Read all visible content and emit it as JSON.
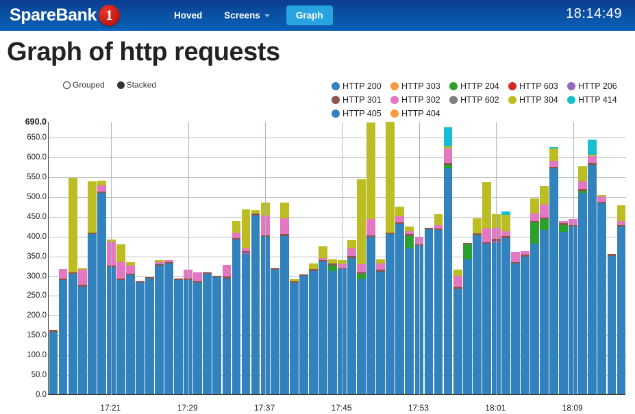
{
  "navbar": {
    "brand_text": "SpareBank",
    "brand_mark": "1",
    "links": [
      {
        "label": "Hoved",
        "active": false,
        "caret": false
      },
      {
        "label": "Screens",
        "active": false,
        "caret": true
      },
      {
        "label": "Graph",
        "active": true,
        "caret": false
      }
    ],
    "clock": "18:14:49",
    "bg_color": "#0a4fa0",
    "active_color": "#27a3e0"
  },
  "page": {
    "title": "Graph of http requests"
  },
  "mode_toggle": {
    "options": [
      {
        "label": "Grouped",
        "selected": false
      },
      {
        "label": "Stacked",
        "selected": true
      }
    ]
  },
  "chart_data": {
    "type": "bar",
    "stacked": true,
    "title": "Graph of http requests",
    "xlabel": "",
    "ylabel": "",
    "ylim": [
      0,
      690
    ],
    "ytick_step": 50,
    "grid": true,
    "legend_position": "top-right",
    "ytick_labels": [
      "0.0",
      "50.0",
      "100.0",
      "150.0",
      "200.0",
      "250.0",
      "300.0",
      "350.0",
      "400.0",
      "450.0",
      "500.0",
      "550.0",
      "600.0",
      "650.0",
      "690.0"
    ],
    "xtick_labels": [
      "17:21",
      "17:29",
      "17:37",
      "17:45",
      "17:53",
      "18:01",
      "18:09"
    ],
    "xtick_indices": [
      6,
      14,
      22,
      30,
      38,
      46,
      54
    ],
    "series": [
      {
        "name": "HTTP 200",
        "color": "#3182bd"
      },
      {
        "name": "HTTP 303",
        "color": "#f99b3a"
      },
      {
        "name": "HTTP 204",
        "color": "#2ca02c"
      },
      {
        "name": "HTTP 603",
        "color": "#d62728"
      },
      {
        "name": "HTTP 206",
        "color": "#9467bd"
      },
      {
        "name": "HTTP 301",
        "color": "#8c564b"
      },
      {
        "name": "HTTP 302",
        "color": "#e377c2"
      },
      {
        "name": "HTTP 602",
        "color": "#7f7f7f"
      },
      {
        "name": "HTTP 304",
        "color": "#bcbd22"
      },
      {
        "name": "HTTP 414",
        "color": "#17becf"
      },
      {
        "name": "HTTP 405",
        "color": "#3182bd"
      },
      {
        "name": "HTTP 404",
        "color": "#f99b3a"
      }
    ],
    "bars": [
      {
        "values": [
          158,
          0,
          0,
          0,
          0,
          5,
          0,
          0,
          0,
          0,
          0,
          0
        ]
      },
      {
        "values": [
          288,
          0,
          0,
          0,
          0,
          4,
          24,
          0,
          0,
          0,
          0,
          0
        ]
      },
      {
        "values": [
          305,
          0,
          0,
          0,
          0,
          3,
          0,
          0,
          238,
          0,
          0,
          0
        ]
      },
      {
        "values": [
          272,
          0,
          0,
          0,
          0,
          4,
          38,
          0,
          4,
          0,
          0,
          0
        ]
      },
      {
        "values": [
          404,
          0,
          0,
          0,
          0,
          5,
          0,
          0,
          128,
          0,
          0,
          0
        ]
      },
      {
        "values": [
          508,
          0,
          0,
          0,
          0,
          4,
          16,
          0,
          12,
          0,
          0,
          0
        ]
      },
      {
        "values": [
          322,
          0,
          0,
          0,
          0,
          4,
          58,
          0,
          6,
          0,
          0,
          0
        ]
      },
      {
        "values": [
          289,
          0,
          0,
          0,
          0,
          4,
          40,
          0,
          45,
          0,
          0,
          0
        ]
      },
      {
        "values": [
          301,
          0,
          0,
          0,
          0,
          3,
          22,
          0,
          8,
          0,
          0,
          0
        ]
      },
      {
        "values": [
          282,
          0,
          0,
          0,
          0,
          3,
          0,
          0,
          0,
          0,
          0,
          0
        ]
      },
      {
        "values": [
          292,
          0,
          0,
          0,
          0,
          3,
          0,
          0,
          0,
          0,
          0,
          0
        ]
      },
      {
        "values": [
          326,
          0,
          0,
          0,
          0,
          3,
          5,
          0,
          5,
          0,
          0,
          0
        ]
      },
      {
        "values": [
          330,
          0,
          0,
          0,
          0,
          3,
          6,
          0,
          0,
          0,
          0,
          0
        ]
      },
      {
        "values": [
          289,
          0,
          0,
          0,
          0,
          3,
          0,
          0,
          0,
          0,
          0,
          0
        ]
      },
      {
        "values": [
          289,
          0,
          0,
          0,
          0,
          4,
          22,
          0,
          0,
          0,
          0,
          0
        ]
      },
      {
        "values": [
          282,
          0,
          0,
          0,
          0,
          4,
          22,
          0,
          0,
          0,
          0,
          0
        ]
      },
      {
        "values": [
          304,
          0,
          0,
          0,
          0,
          3,
          0,
          0,
          0,
          0,
          0,
          0
        ]
      },
      {
        "values": [
          296,
          0,
          0,
          0,
          0,
          4,
          0,
          0,
          0,
          0,
          0,
          0
        ]
      },
      {
        "values": [
          293,
          0,
          0,
          0,
          0,
          4,
          30,
          0,
          0,
          0,
          0,
          0
        ]
      },
      {
        "values": [
          390,
          0,
          0,
          0,
          0,
          4,
          14,
          0,
          30,
          0,
          0,
          0
        ]
      },
      {
        "values": [
          352,
          0,
          0,
          0,
          6,
          4,
          6,
          0,
          99,
          0,
          0,
          0
        ]
      },
      {
        "values": [
          452,
          0,
          0,
          0,
          0,
          4,
          0,
          0,
          10,
          0,
          0,
          0
        ]
      },
      {
        "values": [
          398,
          0,
          0,
          0,
          0,
          4,
          50,
          0,
          32,
          0,
          0,
          0
        ]
      },
      {
        "values": [
          314,
          0,
          0,
          0,
          0,
          4,
          0,
          0,
          0,
          0,
          0,
          0
        ]
      },
      {
        "values": [
          400,
          0,
          0,
          0,
          0,
          4,
          40,
          0,
          40,
          0,
          0,
          0
        ]
      },
      {
        "values": [
          282,
          0,
          0,
          0,
          0,
          3,
          0,
          0,
          5,
          0,
          0,
          0
        ]
      },
      {
        "values": [
          300,
          0,
          0,
          0,
          0,
          3,
          0,
          0,
          0,
          0,
          0,
          0
        ]
      },
      {
        "values": [
          312,
          0,
          0,
          0,
          0,
          4,
          0,
          0,
          15,
          0,
          0,
          0
        ]
      },
      {
        "values": [
          335,
          0,
          0,
          0,
          0,
          4,
          5,
          0,
          30,
          0,
          0,
          0
        ]
      },
      {
        "values": [
          312,
          0,
          14,
          0,
          0,
          4,
          0,
          0,
          10,
          0,
          0,
          0
        ]
      },
      {
        "values": [
          316,
          0,
          0,
          0,
          0,
          3,
          10,
          0,
          10,
          0,
          0,
          0
        ]
      },
      {
        "values": [
          345,
          0,
          0,
          0,
          0,
          4,
          20,
          0,
          20,
          0,
          0,
          0
        ]
      },
      {
        "values": [
          290,
          0,
          14,
          0,
          0,
          4,
          20,
          0,
          215,
          0,
          0,
          0
        ]
      },
      {
        "values": [
          398,
          0,
          0,
          0,
          0,
          4,
          40,
          0,
          245,
          0,
          0,
          0
        ]
      },
      {
        "values": [
          310,
          0,
          0,
          0,
          0,
          4,
          16,
          0,
          10,
          0,
          0,
          0
        ]
      },
      {
        "values": [
          405,
          0,
          0,
          0,
          0,
          4,
          0,
          0,
          280,
          0,
          0,
          0
        ]
      },
      {
        "values": [
          430,
          0,
          0,
          0,
          0,
          4,
          16,
          0,
          24,
          0,
          0,
          0
        ]
      },
      {
        "values": [
          368,
          0,
          32,
          0,
          0,
          4,
          8,
          0,
          12,
          0,
          0,
          0
        ]
      },
      {
        "values": [
          375,
          0,
          0,
          0,
          0,
          4,
          18,
          0,
          0,
          0,
          0,
          0
        ]
      },
      {
        "values": [
          416,
          0,
          0,
          0,
          0,
          4,
          0,
          0,
          0,
          0,
          0,
          0
        ]
      },
      {
        "values": [
          415,
          0,
          0,
          0,
          0,
          4,
          8,
          0,
          28,
          0,
          0,
          0
        ]
      },
      {
        "values": [
          570,
          0,
          10,
          0,
          0,
          4,
          36,
          0,
          6,
          48,
          0,
          0
        ]
      },
      {
        "values": [
          267,
          0,
          0,
          0,
          0,
          4,
          28,
          0,
          16,
          0,
          0,
          0
        ]
      },
      {
        "values": [
          340,
          0,
          38,
          0,
          0,
          4,
          0,
          0,
          0,
          0,
          0,
          0
        ]
      },
      {
        "values": [
          402,
          0,
          0,
          0,
          0,
          4,
          0,
          0,
          38,
          0,
          0,
          0
        ]
      },
      {
        "values": [
          380,
          0,
          0,
          0,
          0,
          4,
          34,
          0,
          118,
          0,
          0,
          0
        ]
      },
      {
        "values": [
          382,
          0,
          0,
          0,
          6,
          4,
          28,
          0,
          34,
          0,
          0,
          0
        ]
      },
      {
        "values": [
          395,
          0,
          0,
          0,
          0,
          4,
          12,
          0,
          42,
          8,
          0,
          0
        ]
      },
      {
        "values": [
          330,
          0,
          0,
          0,
          0,
          4,
          26,
          0,
          0,
          0,
          0,
          0
        ]
      },
      {
        "values": [
          348,
          0,
          0,
          0,
          0,
          4,
          10,
          0,
          0,
          0,
          0,
          0
        ]
      },
      {
        "values": [
          380,
          0,
          54,
          0,
          0,
          4,
          18,
          0,
          38,
          0,
          0,
          0
        ]
      },
      {
        "values": [
          415,
          0,
          28,
          0,
          0,
          4,
          32,
          0,
          46,
          0,
          0,
          0
        ]
      },
      {
        "values": [
          570,
          0,
          0,
          0,
          0,
          4,
          16,
          0,
          30,
          4,
          0,
          0
        ]
      },
      {
        "values": [
          410,
          0,
          18,
          0,
          0,
          4,
          6,
          0,
          0,
          0,
          0,
          0
        ]
      },
      {
        "values": [
          424,
          0,
          0,
          0,
          0,
          4,
          14,
          0,
          0,
          0,
          0,
          0
        ]
      },
      {
        "values": [
          508,
          0,
          6,
          0,
          0,
          4,
          20,
          0,
          38,
          0,
          0,
          0
        ]
      },
      {
        "values": [
          580,
          0,
          0,
          0,
          0,
          4,
          18,
          0,
          4,
          38,
          0,
          0
        ]
      },
      {
        "values": [
          482,
          0,
          0,
          0,
          0,
          4,
          14,
          0,
          4,
          0,
          0,
          0
        ]
      },
      {
        "values": [
          350,
          0,
          0,
          0,
          0,
          4,
          0,
          0,
          0,
          0,
          0,
          0
        ]
      },
      {
        "values": [
          424,
          0,
          0,
          0,
          0,
          4,
          10,
          0,
          40,
          0,
          0,
          0
        ]
      }
    ]
  }
}
